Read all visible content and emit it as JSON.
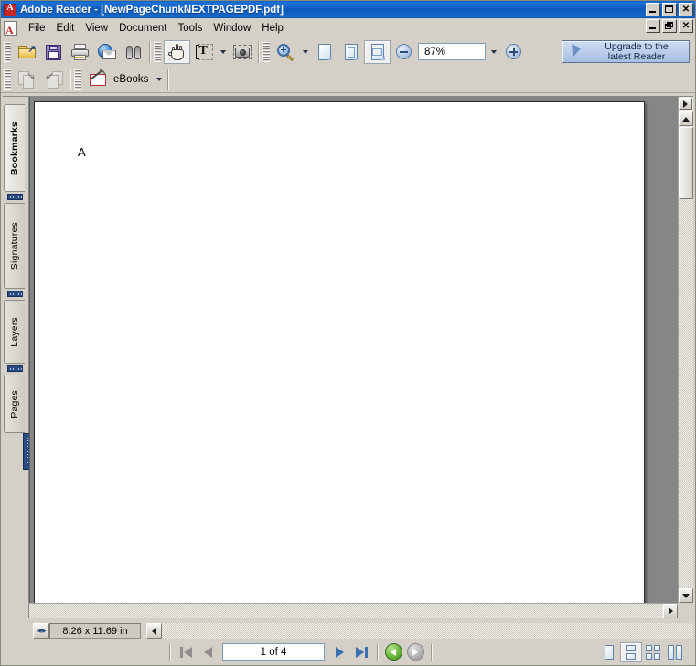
{
  "window": {
    "app_name": "Adobe Reader",
    "title": "Adobe Reader - [NewPageChunkNEXTPAGEPDF.pdf]",
    "document_name": "NewPageChunkNEXTPAGEPDF.pdf",
    "app_icon": "adobe-reader-icon",
    "controls": {
      "minimize": "_",
      "maximize": "□",
      "restore": "❐",
      "close": "×"
    }
  },
  "menubar": {
    "doc_icon": "pdf-document-icon",
    "items": [
      {
        "label": "File"
      },
      {
        "label": "Edit"
      },
      {
        "label": "View"
      },
      {
        "label": "Document"
      },
      {
        "label": "Tools"
      },
      {
        "label": "Window"
      },
      {
        "label": "Help"
      }
    ]
  },
  "toolbar_main": {
    "file_group": [
      {
        "name": "open-file-button",
        "icon": "open-folder-icon"
      },
      {
        "name": "save-button",
        "icon": "floppy-disk-icon"
      },
      {
        "name": "print-button",
        "icon": "printer-icon"
      },
      {
        "name": "email-button",
        "icon": "globe-envelope-icon"
      },
      {
        "name": "search-button",
        "icon": "binoculars-icon"
      }
    ],
    "tools_group": [
      {
        "name": "hand-tool-button",
        "icon": "hand-icon",
        "pressed": true
      },
      {
        "name": "select-text-tool-button",
        "icon": "text-select-icon",
        "has_dropdown": true
      },
      {
        "name": "snapshot-tool-button",
        "icon": "camera-snapshot-icon"
      }
    ],
    "zoom_group": [
      {
        "name": "zoom-tool-button",
        "icon": "magnifier-icon",
        "has_dropdown": true
      },
      {
        "name": "actual-size-button",
        "icon": "page-actual-size-icon"
      },
      {
        "name": "fit-page-button",
        "icon": "page-fit-icon"
      },
      {
        "name": "fit-width-button",
        "icon": "page-fit-width-icon",
        "pressed": true
      }
    ],
    "zoom_out_icon": "zoom-out-circle-icon",
    "zoom_in_icon": "zoom-in-circle-icon",
    "zoom_value": "87%",
    "upgrade": {
      "icon": "cursor-arrow-icon",
      "line1": "Upgrade to the",
      "line2": "latest Reader"
    }
  },
  "toolbar_secondary": {
    "history_group": [
      {
        "name": "previous-view-button",
        "icon": "previous-view-icon",
        "enabled": false
      },
      {
        "name": "next-view-button",
        "icon": "next-view-icon",
        "enabled": false
      }
    ],
    "ebooks": {
      "icon": "ebooks-icon",
      "label": "eBooks",
      "has_dropdown": true
    }
  },
  "navigation_pane": {
    "tabs": [
      {
        "label": "Bookmarks",
        "active": true
      },
      {
        "label": "Signatures",
        "active": false
      },
      {
        "label": "Layers",
        "active": false
      },
      {
        "label": "Pages",
        "active": false
      }
    ]
  },
  "document": {
    "page_content": "A",
    "page_size_label": "8.26 x 11.69 in"
  },
  "statusbar": {
    "page_size": "8.26 x 11.69 in",
    "page_indicator": "1 of 4",
    "current_page": 1,
    "total_pages": 4,
    "nav": [
      {
        "name": "first-page-button",
        "icon": "first-page-icon",
        "enabled": false
      },
      {
        "name": "previous-page-button",
        "icon": "previous-page-icon",
        "enabled": false
      },
      {
        "name": "next-page-button",
        "icon": "next-page-icon",
        "enabled": true
      },
      {
        "name": "last-page-button",
        "icon": "last-page-icon",
        "enabled": true
      }
    ],
    "view_history": [
      {
        "name": "go-back-button",
        "icon": "back-circle-icon",
        "enabled": true
      },
      {
        "name": "go-forward-button",
        "icon": "forward-circle-icon",
        "enabled": false
      }
    ],
    "layout_buttons": [
      {
        "name": "single-page-layout-button",
        "icon": "single-page-icon",
        "pressed": false
      },
      {
        "name": "continuous-layout-button",
        "icon": "continuous-page-icon",
        "pressed": true
      },
      {
        "name": "facing-layout-button",
        "icon": "facing-pages-icon",
        "pressed": false
      },
      {
        "name": "continuous-facing-layout-button",
        "icon": "continuous-facing-icon",
        "pressed": false
      }
    ]
  },
  "colors": {
    "titlebar_blue": "#0c5bbd",
    "chrome": "#d4d0c8",
    "document_bg": "#868686",
    "page_white": "#ffffff",
    "accent_blue": "#3d6fb5",
    "enabled_green": "#69b83c",
    "tab_grip_navy": "#2a4a80"
  }
}
